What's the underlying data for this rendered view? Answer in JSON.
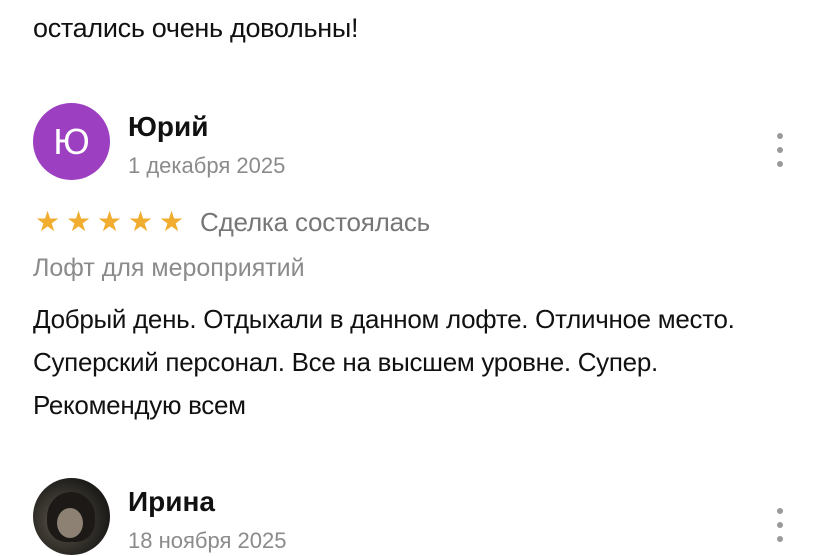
{
  "previous_review": {
    "text_tail": "остались очень довольны!"
  },
  "reviews": [
    {
      "avatar_letter": "Ю",
      "avatar_color": "#9c3fc0",
      "name": "Юрий",
      "date": "1 декабря 2025",
      "rating": 5,
      "stars": [
        "★",
        "★",
        "★",
        "★",
        "★"
      ],
      "deal_status": "Сделка состоялась",
      "category": "Лофт для мероприятий",
      "text": "Добрый день. Отдыхали в данном лофте. Отличное место. Суперский персонал. Все на высшем уровне. Супер. Рекомендую всем",
      "menu_icon": "more-vertical-icon"
    },
    {
      "avatar_type": "photo",
      "name": "Ирина",
      "date": "18 ноября 2025",
      "menu_icon": "more-vertical-icon"
    }
  ],
  "colors": {
    "star": "#f0ad2f",
    "secondary_text": "#8b8b8b"
  }
}
